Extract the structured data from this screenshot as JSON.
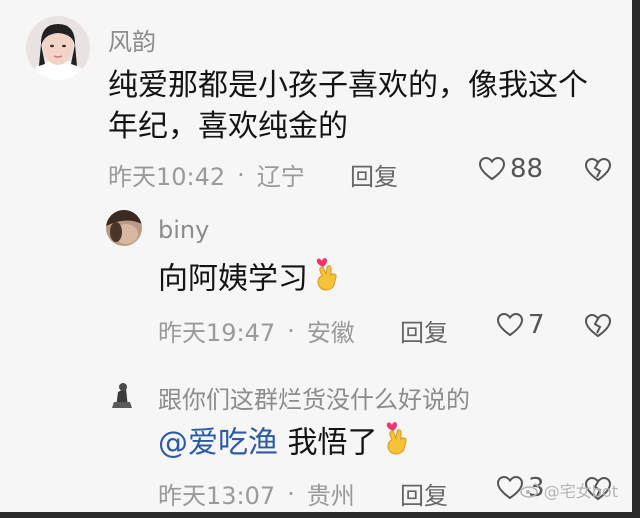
{
  "comments": [
    {
      "username": "风韵",
      "text_line1": "纯爱那都是小孩子喜欢的，像我这个",
      "text_line2": "年纪，喜欢纯金的",
      "time": "昨天10:42",
      "location": "辽宁",
      "reply_label": "回复",
      "likes": "88"
    },
    {
      "username": "biny",
      "text": "向阿姨学习",
      "time": "昨天19:47",
      "location": "安徽",
      "reply_label": "回复",
      "likes": "7"
    },
    {
      "username": "跟你们这群烂货没什么好说的",
      "mention": "@爱吃渔",
      "text": "我悟了",
      "time": "昨天13:07",
      "location": "贵州",
      "reply_label": "回复",
      "likes": "3"
    }
  ],
  "meta_separator": "·",
  "watermark": "@宅女bot",
  "icons": {
    "like": "heart-outline-icon",
    "dislike": "broken-heart-icon",
    "emoji": "finger-heart-emoji-icon"
  },
  "colors": {
    "mention": "#2b5aa6",
    "meta": "#9a9a9a",
    "text": "#141414"
  }
}
